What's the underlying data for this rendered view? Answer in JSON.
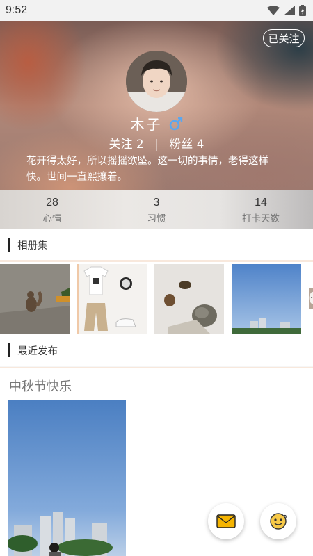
{
  "status_bar": {
    "time": "9:52"
  },
  "header": {
    "follow_badge": "已关注",
    "user_name": "木子",
    "gender_icon": "male-icon",
    "following_label": "关注",
    "following_count": "2",
    "fans_label": "粉丝",
    "fans_count": "4",
    "bio": "花开得太好，所以摇摇欲坠。这一切的事情，老得这样快。世间一直熙攘着。"
  },
  "counts": [
    {
      "value": "28",
      "label": "心情"
    },
    {
      "value": "3",
      "label": "习惯"
    },
    {
      "value": "14",
      "label": "打卡天数"
    }
  ],
  "album": {
    "title": "相册集",
    "thumbs": [
      "squirrel-photo",
      "outfit-photo",
      "turtle-photo",
      "sky-photo",
      "cat-photo"
    ]
  },
  "recent": {
    "title": "最近发布",
    "post_title": "中秋节快乐"
  },
  "fabs": {
    "mail_icon": "mail-icon",
    "emoji_icon": "emoji-icon"
  },
  "colors": {
    "accent_bar": "#222222",
    "gender": "#5aa7f0",
    "envelope": "#f5b400"
  }
}
